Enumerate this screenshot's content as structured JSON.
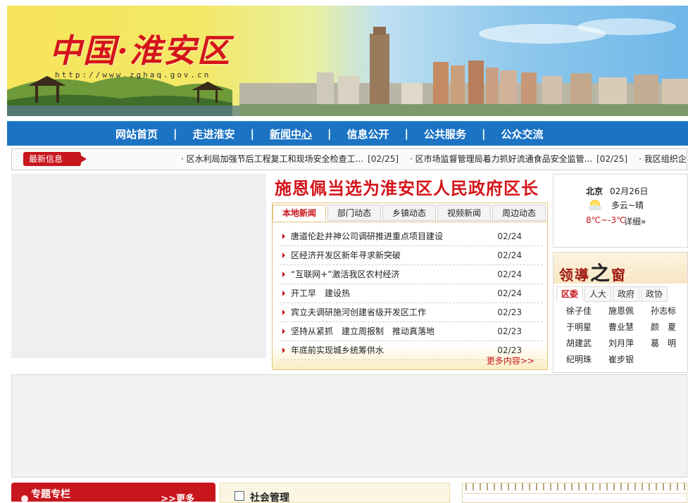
{
  "banner": {
    "logo_text": "中国·淮安区",
    "url_text": "http://www.zghaq.gov.cn"
  },
  "nav": {
    "items": [
      "网站首页",
      "走进淮安",
      "新闻中心",
      "信息公开",
      "公共服务",
      "公众交流"
    ],
    "active_index": 2
  },
  "ticker": {
    "label": "最新信息",
    "items": [
      {
        "title": "· 区水利局加强节后工程复工和现场安全检查工...",
        "date": "[02/25]"
      },
      {
        "title": "· 区市场监督管理局着力抓好流通食品安全监管...",
        "date": "[02/25]"
      },
      {
        "title": "· 我区组织企",
        "date": ""
      }
    ]
  },
  "headline": "施恩佩当选为淮安区人民政府区长",
  "news": {
    "tabs": [
      "本地新闻",
      "部门动态",
      "乡镇动态",
      "视频新闻",
      "周边动态"
    ],
    "active_tab": 0,
    "items": [
      {
        "title": "唐道伦赴井神公司调研推进重点项目建设",
        "date": "02/24"
      },
      {
        "title": "区经济开发区新年寻求新突破",
        "date": "02/24"
      },
      {
        "title": "“互联网+”激活我区农村经济",
        "date": "02/24"
      },
      {
        "title": "开工早　建设热",
        "date": "02/24"
      },
      {
        "title": "宾立夫调研施河创建省级开发区工作",
        "date": "02/23"
      },
      {
        "title": "坚持从紧抓　建立周报制　推动真落地",
        "date": "02/23"
      },
      {
        "title": "年底前实现城乡统筹供水",
        "date": "02/23"
      }
    ],
    "more": "更多内容>>"
  },
  "weather": {
    "city": "北京",
    "date": "02月26日",
    "condition": "多云~晴",
    "temp": "8℃~-3℃",
    "detail": "详细»"
  },
  "leaders": {
    "title_a": "领導",
    "title_b": "之",
    "title_c": "窗",
    "tabs": [
      "区委",
      "人大",
      "政府",
      "政协"
    ],
    "active_tab": 0,
    "names": [
      "徐子佳",
      "施恩佩",
      "孙志标",
      "于明星",
      "曹业慧",
      "颜　夏",
      "胡建武",
      "刘月萍",
      "葛　明",
      "纪明珠",
      "崔步银"
    ]
  },
  "special": {
    "title": "专题专栏",
    "more": ">>更多"
  },
  "social": {
    "title": "社会管理"
  },
  "colors": {
    "brand_red": "#c8161d",
    "nav_blue": "#1c73c4",
    "panel_border": "#e2c47a"
  }
}
